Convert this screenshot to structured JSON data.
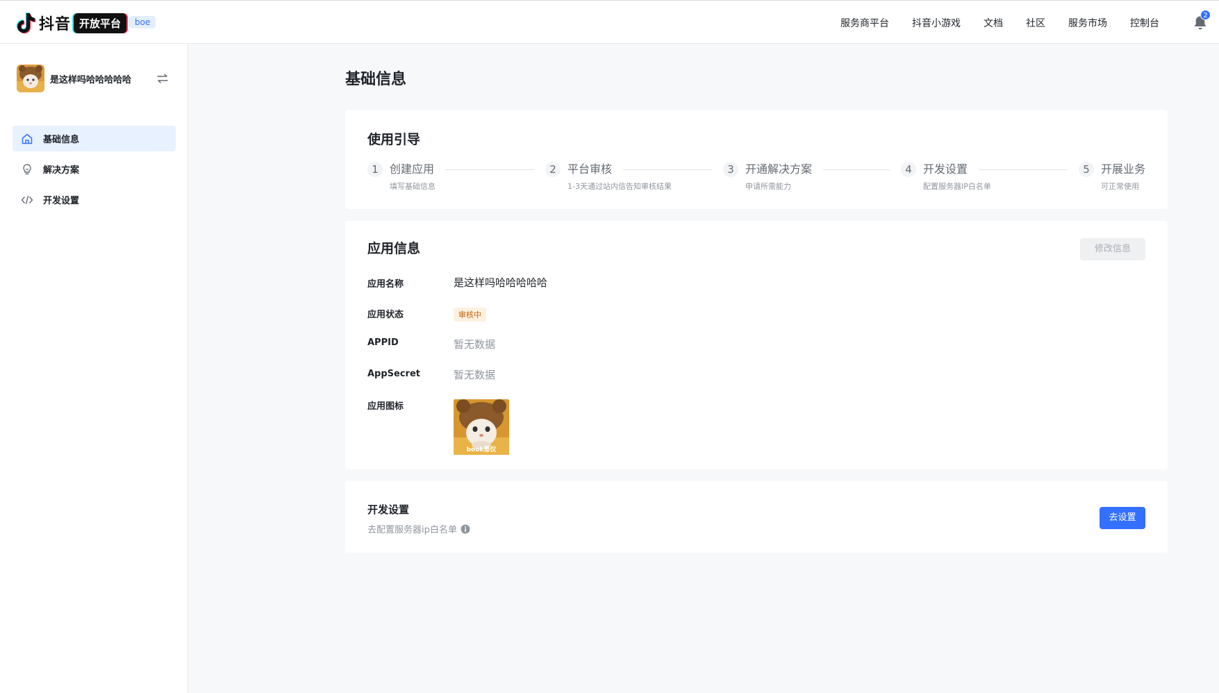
{
  "header": {
    "logo_text": "抖音",
    "logo_pill": "开放平台",
    "env_badge": "boe",
    "nav": [
      "服务商平台",
      "抖音小游戏",
      "文档",
      "社区",
      "服务市场",
      "控制台"
    ],
    "notification_count": "2",
    "icons": {
      "logo": "tiktok-note-icon",
      "bell": "bell-icon"
    }
  },
  "sidebar": {
    "app_name": "是这样吗哈哈哈哈哈",
    "switch_icon": "swap-icon",
    "items": [
      {
        "label": "基础信息",
        "icon": "home-icon",
        "active": true
      },
      {
        "label": "解决方案",
        "icon": "lightbulb-icon",
        "active": false
      },
      {
        "label": "开发设置",
        "icon": "code-icon",
        "active": false
      }
    ]
  },
  "main": {
    "page_title": "基础信息",
    "guide": {
      "title": "使用引导",
      "steps": [
        {
          "num": "1",
          "label": "创建应用",
          "desc": "填写基础信息"
        },
        {
          "num": "2",
          "label": "平台审核",
          "desc": "1-3天通过站内信告知审核结果"
        },
        {
          "num": "3",
          "label": "开通解决方案",
          "desc": "申请所需能力"
        },
        {
          "num": "4",
          "label": "开发设置",
          "desc": "配置服务器IP白名单"
        },
        {
          "num": "5",
          "label": "开展业务",
          "desc": "可正常使用"
        }
      ]
    },
    "app_info": {
      "title": "应用信息",
      "edit_button": "修改信息",
      "fields": {
        "name_label": "应用名称",
        "name_value": "是这样吗哈哈哈哈哈",
        "status_label": "应用状态",
        "status_value": "审核中",
        "appid_label": "APPID",
        "appid_value": "暂无数据",
        "secret_label": "AppSecret",
        "secret_value": "暂无数据",
        "icon_label": "应用图标",
        "icon_caption": "book恩仪"
      },
      "colors": {
        "status_bg": "#fff1e0",
        "status_text": "#c2620c"
      }
    },
    "dev_settings": {
      "title": "开发设置",
      "desc": "去配置服务器ip白名单",
      "info_icon": "info-icon",
      "button": "去设置"
    }
  },
  "colors": {
    "accent": "#3370ff",
    "background": "#f7f8fa",
    "active_menu": "#e8f1ff"
  }
}
